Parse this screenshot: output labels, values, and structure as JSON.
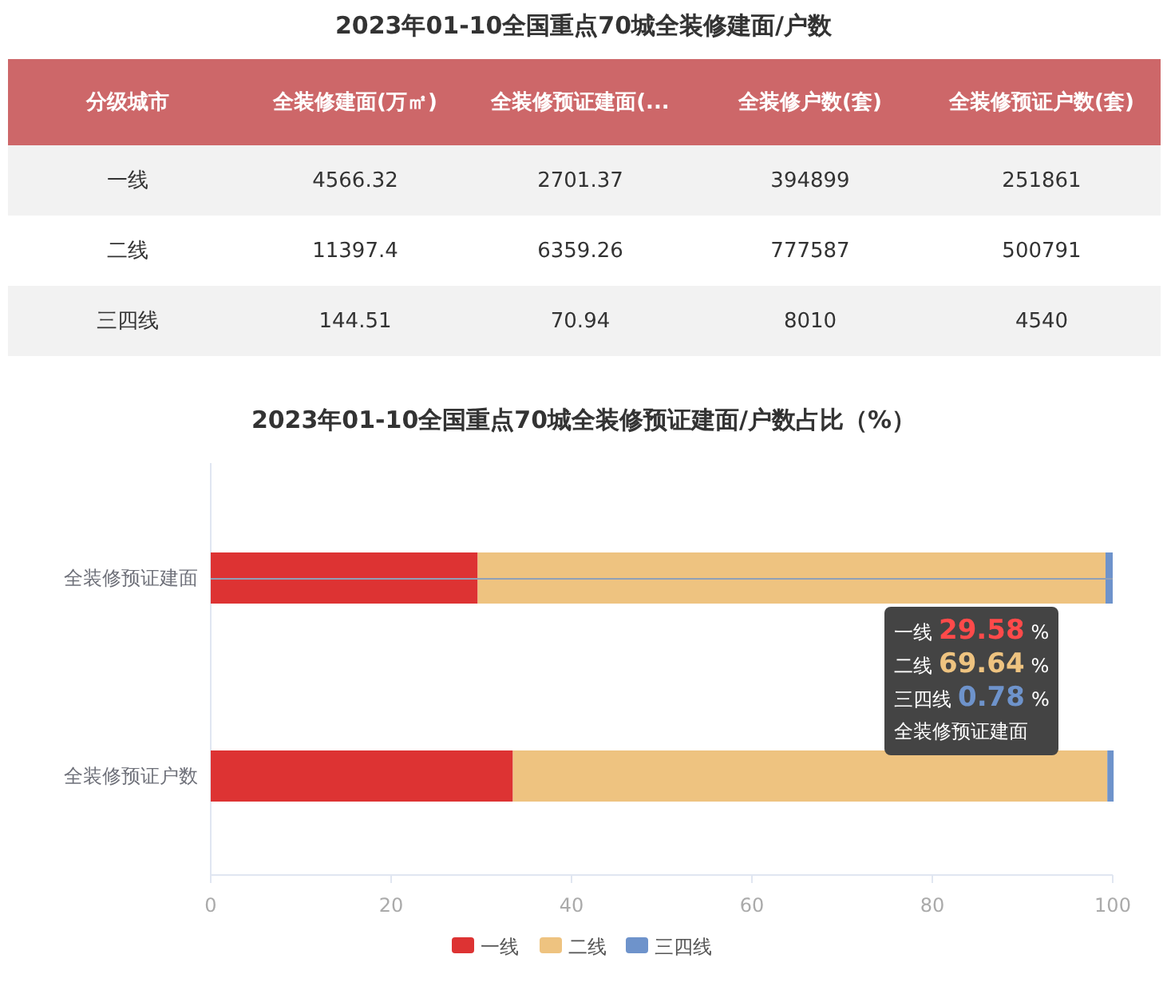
{
  "table": {
    "title": "2023年01-10全国重点70城全装修建面/户数",
    "columns": [
      "分级城市",
      "全装修建面(万㎡)",
      "全装修预证建面(...",
      "全装修户数(套)",
      "全装修预证户数(套)"
    ],
    "rows": [
      [
        "一线",
        "4566.32",
        "2701.37",
        "394899",
        "251861"
      ],
      [
        "二线",
        "11397.4",
        "6359.26",
        "777587",
        "500791"
      ],
      [
        "三四线",
        "144.51",
        "70.94",
        "8010",
        "4540"
      ]
    ]
  },
  "chart": {
    "chart_data": {
      "type": "bar",
      "orientation": "horizontal",
      "stacked": true,
      "title": "2023年01-10全国重点70城全装修预证建面/户数占比（%）",
      "categories": [
        "全装修预证建面",
        "全装修预证户数"
      ],
      "series": [
        {
          "name": "一线",
          "color": "#dd3333",
          "values": [
            29.6,
            33.5
          ]
        },
        {
          "name": "二线",
          "color": "#eec380",
          "values": [
            69.6,
            65.9
          ]
        },
        {
          "name": "三四线",
          "color": "#6e93cb",
          "values": [
            0.8,
            0.7
          ]
        }
      ],
      "legend": true,
      "xlim": [
        0,
        100
      ],
      "xticks": [
        0,
        20,
        40,
        60,
        80,
        100
      ]
    },
    "tooltip": {
      "items": [
        {
          "label": "一线",
          "value": "29.58",
          "unit": "%",
          "color": "#ff4a4a"
        },
        {
          "label": "二线",
          "value": "69.64",
          "unit": "%",
          "color": "#eec380"
        },
        {
          "label": "三四线",
          "value": "0.78",
          "unit": "%",
          "color": "#6e93cb"
        }
      ],
      "title": "全装修预证建面",
      "pointer_line": true
    }
  }
}
